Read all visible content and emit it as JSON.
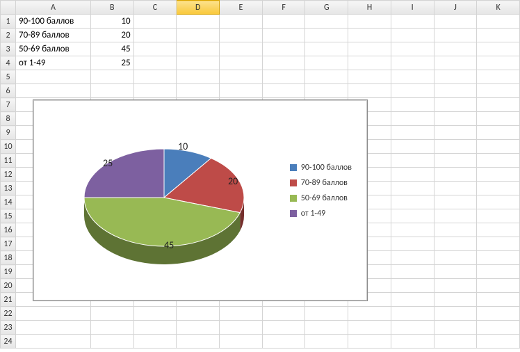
{
  "columns": [
    "A",
    "B",
    "C",
    "D",
    "E",
    "F",
    "G",
    "H",
    "I",
    "J",
    "K"
  ],
  "rows": 24,
  "selected_column": "D",
  "cells": {
    "A1": "90-100 баллов",
    "B1": "10",
    "A2": "70-89 баллов",
    "B2": "20",
    "A3": "50-69 баллов",
    "B3": "45",
    "A4": "от 1-49",
    "B4": "25"
  },
  "chart_data": {
    "type": "pie",
    "title": "",
    "series": [
      {
        "name": "90-100 баллов",
        "value": 10,
        "color": "#4a7ebb"
      },
      {
        "name": "70-89 баллов",
        "value": 20,
        "color": "#be4b48"
      },
      {
        "name": "50-69 баллов",
        "value": 45,
        "color": "#98b954"
      },
      {
        "name": "от 1-49",
        "value": 25,
        "color": "#7d60a0"
      }
    ],
    "data_labels": true,
    "legend_position": "right",
    "style_3d": true
  }
}
